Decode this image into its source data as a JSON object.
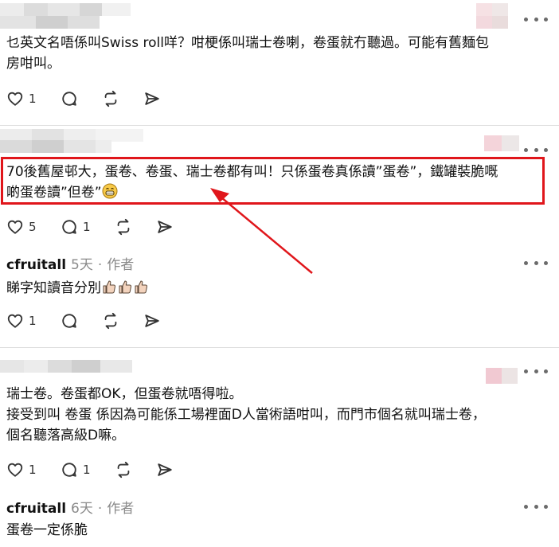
{
  "comments": [
    {
      "lines": [
        "乜英文名唔係叫Swiss roll咩？咁梗係叫瑞士卷喇，卷蛋就冇聽過。可能有舊麵包",
        "房咁叫。"
      ],
      "likes": "1",
      "replies": ""
    },
    {
      "lines": [
        "70後舊屋邨大，蛋卷、卷蛋、瑞士卷都有叫！只係蛋卷真係讀”蛋卷”，鐵罐裝脆嘅",
        "啲蛋卷讀”但卷”"
      ],
      "likes": "5",
      "replies": "1"
    },
    {
      "author": "cfruitall",
      "time": "5天",
      "role": "作者",
      "lines": [
        "睇字知讀音分別"
      ],
      "likes": "1",
      "replies": ""
    },
    {
      "lines": [
        "瑞士卷。卷蛋都OK，但蛋卷就唔得啦。",
        "接受到叫 卷蛋 係因為可能係工場裡面D人當術語咁叫，而門市個名就叫瑞士卷，",
        "個名聽落高級D嘛。"
      ],
      "likes": "1",
      "replies": "1"
    },
    {
      "author": "cfruitall",
      "time": "6天",
      "role": "作者",
      "lines": [
        "蛋卷一定係脆"
      ]
    }
  ],
  "separator": "·",
  "icons": {
    "like": "heart-icon",
    "reply": "comment-bubble-icon",
    "repost": "repost-arrows-icon",
    "share": "send-arrow-icon",
    "more": "more-dots-icon",
    "emoji_grin": "grinning-face-emoji",
    "emoji_thumb": "thumbs-up-emoji"
  },
  "colors": {
    "highlight_border": "#e0161b",
    "annotation_arrow": "#e0161b"
  }
}
